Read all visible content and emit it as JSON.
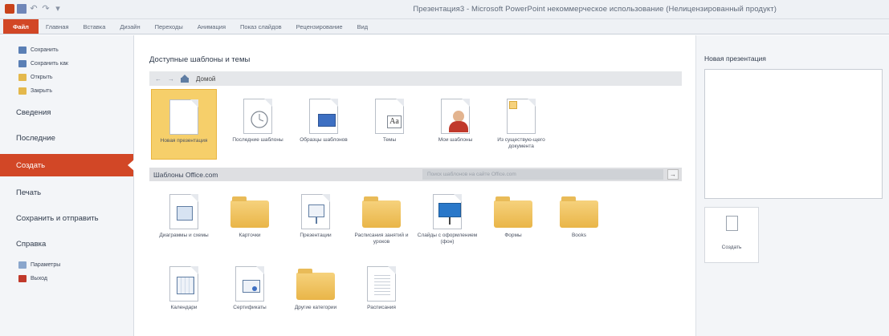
{
  "window": {
    "title": "Презентация3 - Microsoft PowerPoint некоммерческое использование (Нелицензированный продукт)"
  },
  "qat": {
    "app_icon": "powerpoint-icon",
    "save_icon": "save-icon",
    "undo_icon": "undo-icon",
    "redo_icon": "redo-icon"
  },
  "ribbon": {
    "tabs": [
      {
        "label": "Файл"
      },
      {
        "label": "Главная"
      },
      {
        "label": "Вставка"
      },
      {
        "label": "Дизайн"
      },
      {
        "label": "Переходы"
      },
      {
        "label": "Анимация"
      },
      {
        "label": "Показ слайдов"
      },
      {
        "label": "Рецензирование"
      },
      {
        "label": "Вид"
      }
    ],
    "active_color": "#d24726"
  },
  "nav": {
    "small_top": [
      {
        "label": "Сохранить",
        "icon": "save-icon",
        "color": "#5a7fb5"
      },
      {
        "label": "Сохранить как",
        "icon": "save-as-icon",
        "color": "#5a7fb5"
      },
      {
        "label": "Открыть",
        "icon": "open-folder-icon",
        "color": "#e4b84c"
      },
      {
        "label": "Закрыть",
        "icon": "close-folder-icon",
        "color": "#e4b84c"
      }
    ],
    "big": [
      {
        "label": "Сведения"
      },
      {
        "label": "Последние"
      },
      {
        "label": "Создать",
        "active": true
      },
      {
        "label": "Печать"
      },
      {
        "label": "Сохранить и отправить"
      },
      {
        "label": "Справка"
      }
    ],
    "small_bottom": [
      {
        "label": "Параметры",
        "icon": "options-icon",
        "color": "#8aa6cc"
      },
      {
        "label": "Выход",
        "icon": "exit-icon",
        "color": "#c0392b"
      }
    ]
  },
  "main": {
    "section_title": "Доступные шаблоны и темы",
    "breadcrumb": {
      "back": "←",
      "forward": "→",
      "home": "Домой"
    },
    "top_tiles": [
      {
        "label": "Новая презентация",
        "icon": "blank-document-icon",
        "selected": true
      },
      {
        "label": "Последние шаблоны",
        "icon": "clock-document-icon"
      },
      {
        "label": "Образцы шаблонов",
        "icon": "sample-templates-icon"
      },
      {
        "label": "Темы",
        "icon": "themes-icon"
      },
      {
        "label": "Мои шаблоны",
        "icon": "user-templates-icon"
      },
      {
        "label": "Из существую-щего документа",
        "icon": "existing-document-icon"
      }
    ],
    "office_bar": {
      "label": "Шаблоны Office.com",
      "search_placeholder": "Поиск шаблонов на сайте Office.com",
      "go": "→"
    },
    "online_row1": [
      {
        "label": "Диаграммы и схемы",
        "icon": "diagram-icon"
      },
      {
        "label": "Карточки",
        "icon": "folder-icon"
      },
      {
        "label": "Презентации",
        "icon": "presentation-icon"
      },
      {
        "label": "Расписания занятий и уроков",
        "icon": "folder-icon"
      },
      {
        "label": "Слайды с оформлением (фон)",
        "icon": "slide-background-icon"
      },
      {
        "label": "Формы",
        "icon": "folder-icon"
      },
      {
        "label": "Books",
        "icon": "folder-icon"
      }
    ],
    "online_row2": [
      {
        "label": "Календари",
        "icon": "calendar-icon"
      },
      {
        "label": "Сертификаты",
        "icon": "certificate-icon"
      },
      {
        "label": "Другие категории",
        "icon": "folder-icon"
      },
      {
        "label": "Расписания",
        "icon": "schedule-icon"
      }
    ]
  },
  "right": {
    "title": "Новая презентация",
    "create_label": "Создать"
  }
}
